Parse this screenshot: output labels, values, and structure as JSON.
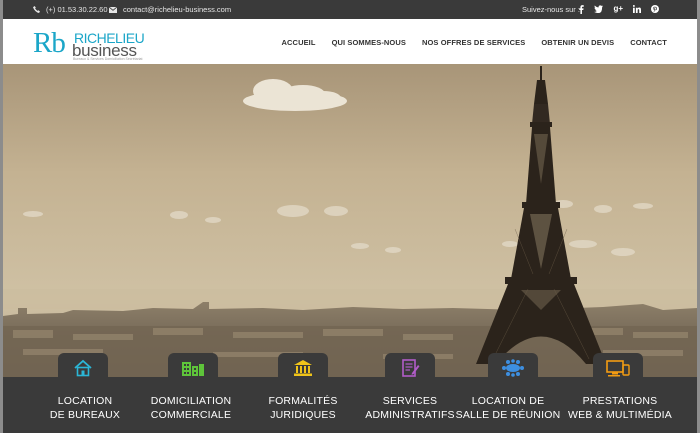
{
  "topbar": {
    "phone": "(+) 01.53.30.22.60",
    "email": "contact@richelieu-business.com",
    "follow_label": "Suivez-nous sur :",
    "social_icons": [
      "facebook-icon",
      "twitter-icon",
      "google-plus-icon",
      "linkedin-icon",
      "pinterest-icon"
    ]
  },
  "logo": {
    "monogram": "Rb",
    "line1": "RICHELIEU",
    "line2": "business",
    "tagline": "Bureaux & Services Domiciliation Secrétariat"
  },
  "nav": {
    "items": [
      "ACCUEIL",
      "QUI SOMMES-NOUS",
      "NOS OFFRES DE SERVICES",
      "OBTENIR UN DEVIS",
      "CONTACT"
    ]
  },
  "services": [
    {
      "line1": "LOCATION",
      "line2": "DE BUREAUX",
      "icon": "house-icon",
      "color": "#2bb6d6"
    },
    {
      "line1": "DOMICILIATION",
      "line2": "COMMERCIALE",
      "icon": "buildings-icon",
      "color": "#5ec43a"
    },
    {
      "line1": "FORMALITÉS",
      "line2": "JURIDIQUES",
      "icon": "courthouse-icon",
      "color": "#f0c419"
    },
    {
      "line1": "SERVICES",
      "line2": "ADMINISTRATIFS",
      "icon": "document-pen-icon",
      "color": "#b15cc9"
    },
    {
      "line1": "LOCATION DE",
      "line2": "SALLE DE RÉUNION",
      "icon": "meeting-table-icon",
      "color": "#3d8fe0"
    },
    {
      "line1": "PRESTATIONS",
      "line2": "WEB & MULTIMÉDIA",
      "icon": "devices-icon",
      "color": "#f39c12"
    }
  ],
  "colors": {
    "accent": "#1ba6c8",
    "topbar_bg": "#3a3a3a",
    "sepia_sky": "#c9b899"
  }
}
